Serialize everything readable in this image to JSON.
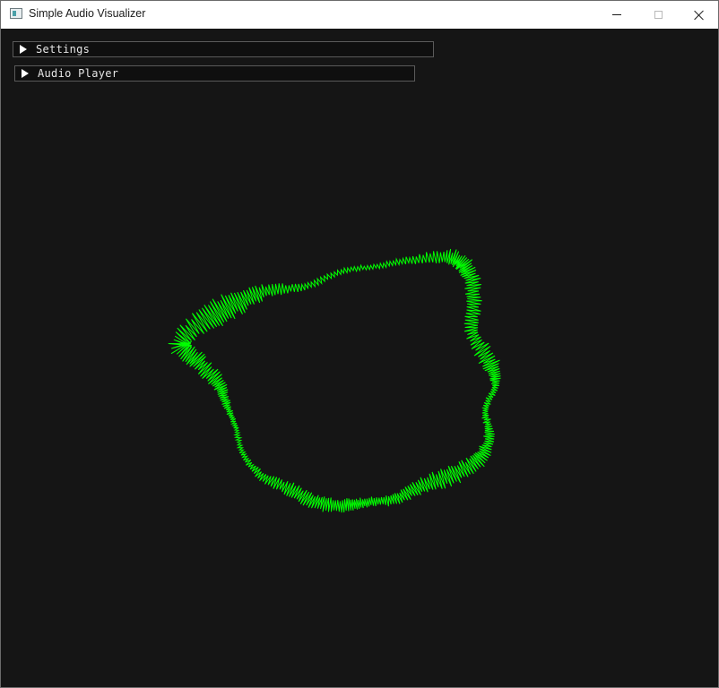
{
  "window": {
    "title": "Simple Audio Visualizer",
    "icon": "app-window-icon"
  },
  "controls": {
    "minimize_icon": "minimize-icon",
    "maximize_icon": "maximize-icon",
    "close_icon": "close-icon"
  },
  "panels": [
    {
      "label": "Settings",
      "expanded": false
    },
    {
      "label": "Audio Player",
      "expanded": false
    }
  ],
  "visualizer": {
    "shape": "circular waveform",
    "stroke_color": "#00ff00",
    "background_color": "#151515"
  }
}
